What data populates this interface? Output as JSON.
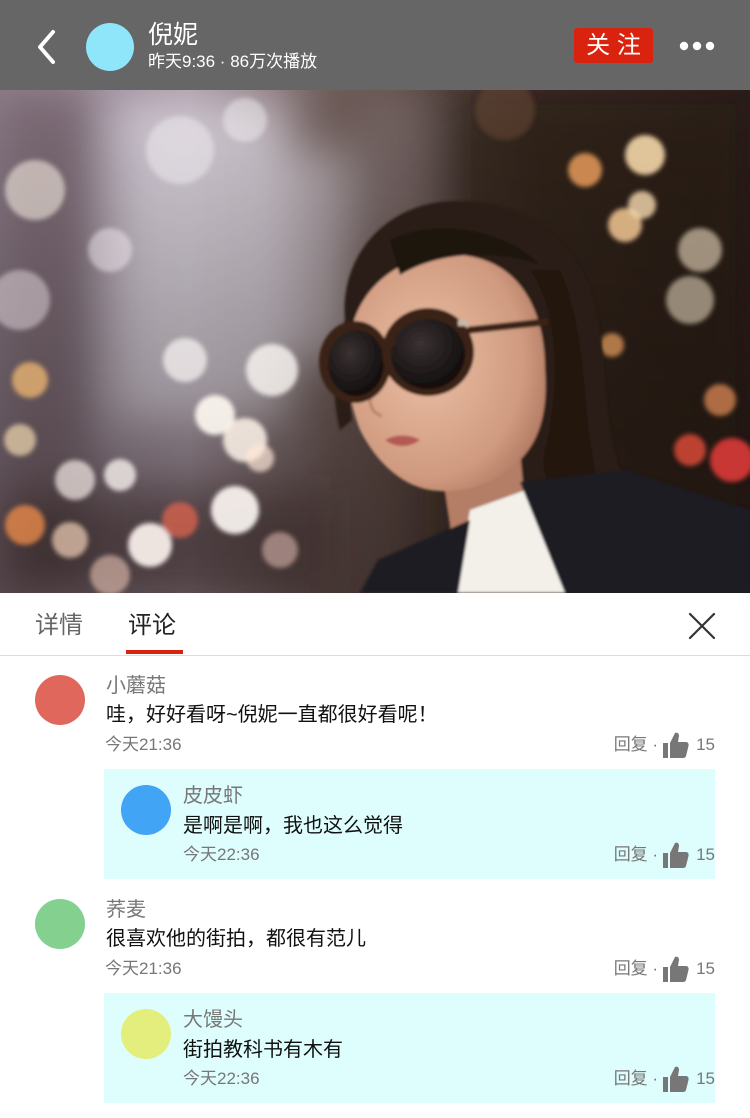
{
  "header": {
    "back_icon": "chevron-left-icon",
    "avatar_color": "#8fe6fb",
    "name": "倪妮",
    "subtitle": "昨天9:36 · 86万次播放",
    "follow_label": "关 注",
    "more_icon": "more-dots-icon"
  },
  "colors": {
    "header_bg": "#666666",
    "accent": "#d9230f",
    "reply_bg": "#defdfd"
  },
  "tabs": [
    {
      "label": "详情",
      "active": false
    },
    {
      "label": "评论",
      "active": true
    }
  ],
  "close_icon": "close-icon",
  "comments": [
    {
      "avatar_color": "#e0675b",
      "name": "小蘑菇",
      "text": "哇，好好看呀~倪妮一直都很好看呢！",
      "time": "今天21:36",
      "reply_label": "回复 ·",
      "like_icon": "thumbs-up-icon",
      "likes": 15,
      "replies": [
        {
          "avatar_color": "#42a4f4",
          "name": "皮皮虾",
          "text": "是啊是啊，我也这么觉得",
          "time": "今天22:36",
          "reply_label": "回复 ·",
          "like_icon": "thumbs-up-icon",
          "likes": 15
        }
      ]
    },
    {
      "avatar_color": "#83d08f",
      "name": "荞麦",
      "text": "很喜欢他的街拍，都很有范儿",
      "time": "今天21:36",
      "reply_label": "回复 ·",
      "like_icon": "thumbs-up-icon",
      "likes": 15,
      "replies": [
        {
          "avatar_color": "#e3ee7c",
          "name": "大馒头",
          "text": "街拍教科书有木有",
          "time": "今天22:36",
          "reply_label": "回复 ·",
          "like_icon": "thumbs-up-icon",
          "likes": 15
        }
      ]
    }
  ]
}
